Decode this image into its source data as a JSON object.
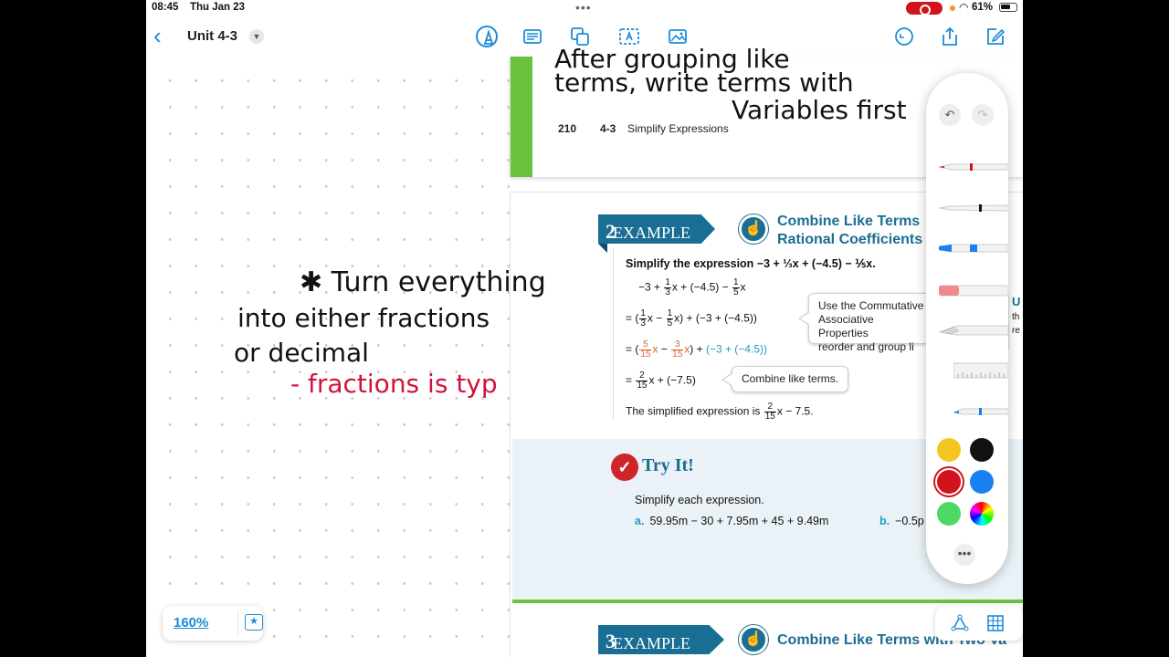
{
  "status": {
    "time": "08:45",
    "date": "Thu Jan 23",
    "battery": "61%"
  },
  "toolbar": {
    "back": "‹",
    "title": "Unit 4-3"
  },
  "page1": {
    "ink_line1": "After grouping like",
    "ink_line2": "terms, write terms with",
    "ink_line3": "Variables first",
    "page_number": "210",
    "section": "4-3",
    "section_name": "Simplify Expressions"
  },
  "example2": {
    "label": "EXAMPLE",
    "number": "2",
    "title_line1": "Combine Like Terms",
    "title_line2": "Rational Coefficients",
    "problem": "Simplify the expression −3 + ⅓x + (−4.5) − ⅕x.",
    "callout1_line1": "Use the Commutative",
    "callout1_line2": "Associative Properties",
    "callout1_line3": "reorder and group li",
    "callout2": "Combine like terms.",
    "result_prefix": "The simplified expression is",
    "result_suffix": "x − 7.5."
  },
  "side_snip": {
    "title": "U",
    "l1": "th",
    "l2": "re"
  },
  "notes": {
    "line1": "✱ Turn everything",
    "line2": "into either fractions",
    "line3": "or decimal",
    "line4": "- fractions is typ"
  },
  "tryit": {
    "title": "Try It!",
    "subtitle": "Simplify each expression.",
    "a_label": "a.",
    "a_expr": "59.95m − 30 + 7.95m + 45 + 9.49m",
    "b_label": "b.",
    "b_expr": "−0.5p"
  },
  "example3": {
    "label": "EXAMPLE",
    "number": "3",
    "title": "Combine Like Terms with Two Va"
  },
  "zoom": {
    "level": "160%"
  },
  "colors": {
    "accent": "#1a8cd8",
    "pearson_blue": "#1a6e93",
    "green": "#6ac23e",
    "ink_red": "#d0133c",
    "swatches": [
      "#f5c623",
      "#111111",
      "#d0131d",
      "#1a7ff0",
      "#4cd964",
      "rainbow"
    ]
  }
}
